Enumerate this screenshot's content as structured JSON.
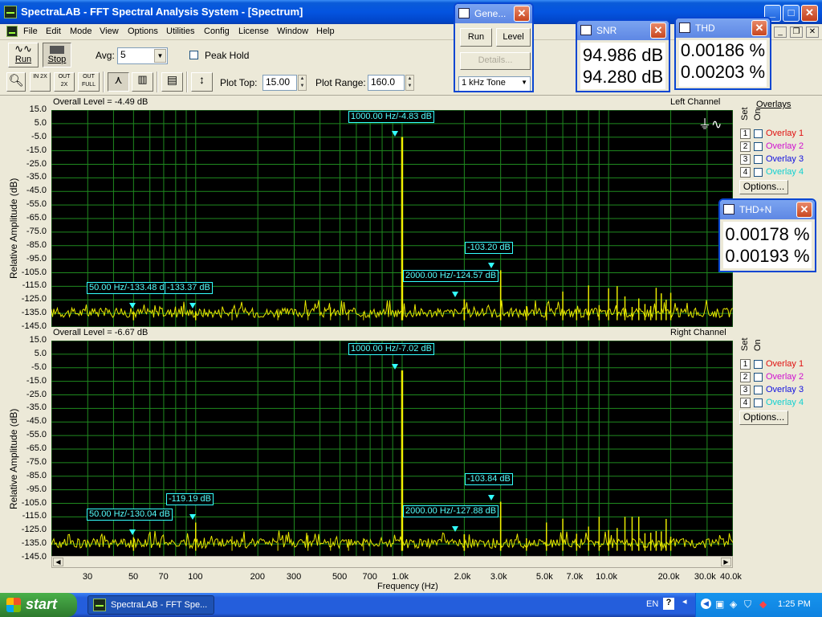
{
  "window": {
    "title": "SpectraLAB - FFT Spectral Analysis System - [Spectrum]"
  },
  "menu": [
    "File",
    "Edit",
    "Mode",
    "View",
    "Options",
    "Utilities",
    "Config",
    "License",
    "Window",
    "Help"
  ],
  "toolbar": {
    "run_label": "Run",
    "stop_label": "Stop",
    "avg_label": "Avg:",
    "avg_value": "5",
    "peak_hold_label": "Peak Hold",
    "plot_top_label": "Plot Top:",
    "plot_top_value": "15.00",
    "plot_range_label": "Plot Range:",
    "plot_range_value": "160.0",
    "zoom_in_label": "IN 2X",
    "zoom_out_label": "OUT 2X",
    "zoom_full_label": "OUT FULL"
  },
  "generator": {
    "title": "Gene...",
    "run_label": "Run",
    "level_label": "Level",
    "details_label": "Details...",
    "tone_value": "1 kHz Tone"
  },
  "snr": {
    "title": "SNR",
    "values": [
      "94.986 dB",
      "94.280 dB"
    ]
  },
  "thd": {
    "title": "THD",
    "values": [
      "0.00186 %",
      "0.00203 %"
    ]
  },
  "thdn": {
    "title": "THD+N",
    "values": [
      "0.00178 %",
      "0.00193 %"
    ]
  },
  "left": {
    "overall": "Overall Level = -4.49 dB",
    "channel": "Left Channel",
    "markers": [
      "1000.00 Hz/-4.83 dB",
      "-103.20 dB",
      "2000.00 Hz/-124.57 dB",
      "50.00 Hz/-133.48 dB",
      "-133.37 dB"
    ]
  },
  "right": {
    "overall": "Overall Level = -6.67 dB",
    "channel": "Right Channel",
    "markers": [
      "1000.00 Hz/-7.02 dB",
      "-103.84 dB",
      "2000.00 Hz/-127.88 dB",
      "50.00 Hz/-130.04 dB",
      "-119.19 dB"
    ]
  },
  "overlays": {
    "header": "Overlays",
    "set_label": "Set",
    "on_label": "On",
    "items": [
      "Overlay 1",
      "Overlay 2",
      "Overlay 3",
      "Overlay 4"
    ],
    "colors": [
      "#e01010",
      "#d010d0",
      "#1010e0",
      "#10d0d0"
    ],
    "options_label": "Options..."
  },
  "axes": {
    "y_title": "Relative Amplitude (dB)",
    "y_ticks": [
      "15.0",
      "5.0",
      "-5.0",
      "-15.0",
      "-25.0",
      "-35.0",
      "-45.0",
      "-55.0",
      "-65.0",
      "-75.0",
      "-85.0",
      "-95.0",
      "-105.0",
      "-115.0",
      "-125.0",
      "-135.0",
      "-145.0"
    ],
    "x_title": "Frequency (Hz)",
    "x_ticks": [
      "30",
      "50",
      "70",
      "100",
      "200",
      "300",
      "500",
      "700",
      "1.0k",
      "2.0k",
      "3.0k",
      "5.0k",
      "7.0k",
      "10.0k",
      "20.0k",
      "30.0k",
      "40.0k"
    ]
  },
  "chart_data": [
    {
      "type": "line",
      "title": "Left Channel",
      "xlabel": "Frequency (Hz)",
      "ylabel": "Relative Amplitude (dB)",
      "xscale": "log",
      "xlim": [
        20,
        40000
      ],
      "ylim": [
        -145,
        15
      ],
      "grid": true,
      "peaks": [
        {
          "x": 50,
          "y": -133.48
        },
        {
          "x": 100,
          "y": -133.37
        },
        {
          "x": 1000,
          "y": -4.83
        },
        {
          "x": 2000,
          "y": -124.57
        },
        {
          "x": 3000,
          "y": -103.2
        }
      ]
    },
    {
      "type": "line",
      "title": "Right Channel",
      "xlabel": "Frequency (Hz)",
      "ylabel": "Relative Amplitude (dB)",
      "xscale": "log",
      "xlim": [
        20,
        40000
      ],
      "ylim": [
        -145,
        15
      ],
      "grid": true,
      "peaks": [
        {
          "x": 50,
          "y": -130.04
        },
        {
          "x": 100,
          "y": -119.19
        },
        {
          "x": 1000,
          "y": -7.02
        },
        {
          "x": 2000,
          "y": -127.88
        },
        {
          "x": 3000,
          "y": -103.84
        }
      ]
    }
  ],
  "taskbar": {
    "start_label": "start",
    "task_label": "SpectraLAB - FFT Spe...",
    "lang": "EN",
    "clock": "1:25 PM"
  }
}
